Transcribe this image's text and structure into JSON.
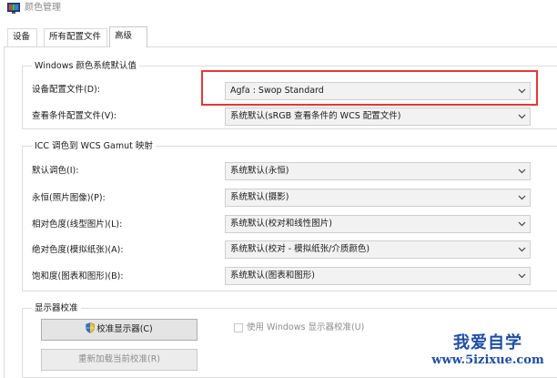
{
  "window": {
    "title": "颜色管理"
  },
  "tabs": [
    {
      "label": "设备"
    },
    {
      "label": "所有配置文件"
    },
    {
      "label": "高级"
    }
  ],
  "windows_defaults": {
    "title": "Windows 颜色系统默认值",
    "device_profile_label": "设备配置文件(D):",
    "device_profile_value": "Agfa : Swop Standard",
    "viewing_conditions_label": "查看条件配置文件(V):",
    "viewing_conditions_value": "系统默认(sRGB 查看条件的 WCS 配置文件)"
  },
  "gamut_mapping": {
    "title": "ICC 调色到 WCS Gamut 映射",
    "rows": [
      {
        "label": "默认调色(I):",
        "value": "系统默认(永恒)"
      },
      {
        "label": "永恒(照片图像)(P):",
        "value": "系统默认(摄影)"
      },
      {
        "label": "相对色度(线型图片)(L):",
        "value": "系统默认(校对和线性图片)"
      },
      {
        "label": "绝对色度(模拟纸张)(A):",
        "value": "系统默认(校对 - 模拟纸张/介质颜色)"
      },
      {
        "label": "饱和度(图表和图形)(B):",
        "value": "系统默认(图表和图形)"
      }
    ]
  },
  "calibration": {
    "title": "显示器校准",
    "calibrate_button": "校准显示器(C)",
    "reload_button": "重新加载当前校准(R)",
    "use_windows_label": "使用 Windows 显示器校准(U)"
  },
  "watermark": {
    "text": "我爱自学",
    "url": "www.5izixue.com"
  },
  "colors": {
    "highlight": "#e53935",
    "watermark": "#1f4ea3"
  }
}
